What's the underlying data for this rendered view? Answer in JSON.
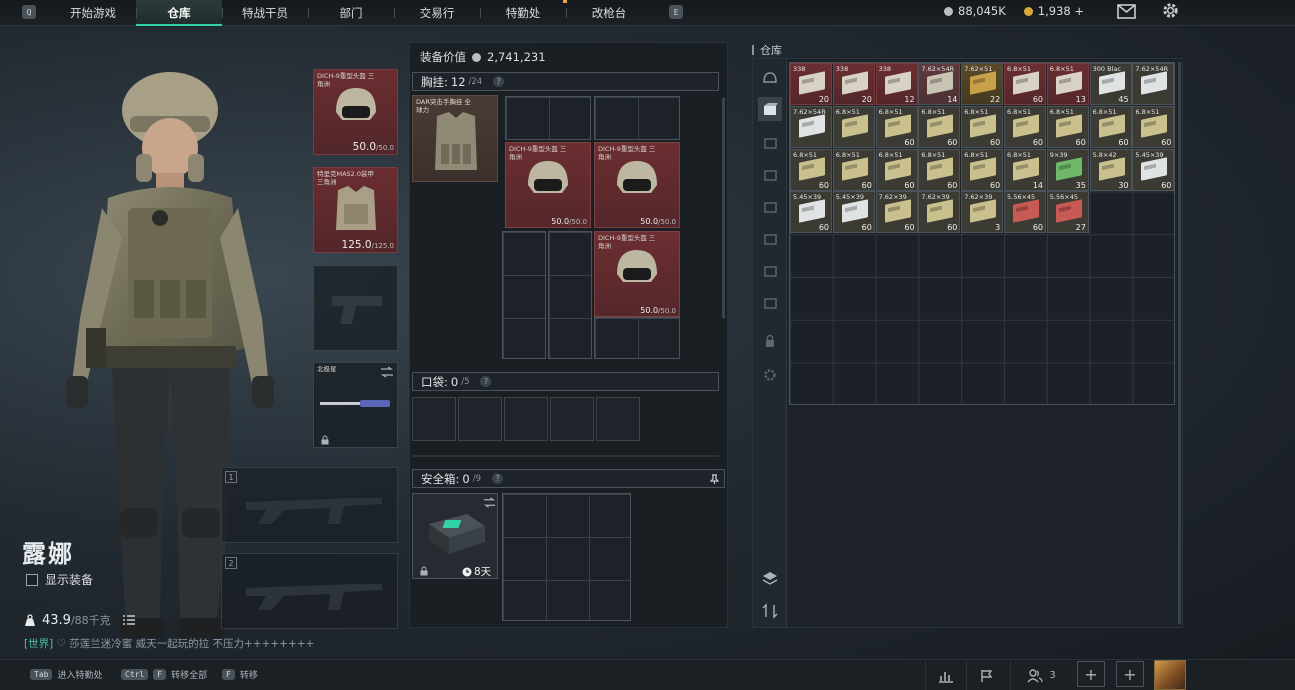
{
  "topbar": {
    "key_left": "Q",
    "key_right": "E",
    "tabs": [
      {
        "label": "开始游戏",
        "active": false
      },
      {
        "label": "仓库",
        "active": true
      },
      {
        "label": "特战干员",
        "active": false
      },
      {
        "label": "部门",
        "active": false
      },
      {
        "label": "交易行",
        "active": false
      },
      {
        "label": "特勤处",
        "active": false
      },
      {
        "label": "改枪台",
        "active": false
      }
    ],
    "currency_silver": "88,045K",
    "currency_gold": "1,938",
    "add_currency": "+",
    "accent_color": "#2fd3a5"
  },
  "character": {
    "name": "露娜",
    "show_gear_label": "显示装备",
    "weight_value": "43.9",
    "weight_max": "/88千克"
  },
  "chat": {
    "channel": "[世界]",
    "text": "♡ 莎莲兰迷冷蜜 威天一起玩的拉 不压力++++++++"
  },
  "equipment": {
    "helmet": {
      "label": "DICH-9重型头盔 三角洲",
      "durability": "50.0",
      "max": "/50.0"
    },
    "armor": {
      "label": "特里克MAS2.0装甲 三角洲",
      "durability": "125.0",
      "max": "/125.0"
    },
    "melee": {
      "label": "北极星"
    },
    "weapon_slots": [
      "1",
      "2"
    ]
  },
  "center": {
    "gear_value_label": "装备价值",
    "gear_value": "2,741,231",
    "chest_rig": {
      "label": "胸挂:",
      "used": "12",
      "cap": "/24",
      "help": "?"
    },
    "rig_item_label": "DAR突击手胸挂 全球力",
    "helmets": [
      {
        "label": "DICH-9重型头盔 三角洲",
        "durability": "50.0",
        "max": "/50.0"
      },
      {
        "label": "DICH-9重型头盔 三角洲",
        "durability": "50.0",
        "max": "/50.0"
      },
      {
        "label": "DICH-9重型头盔 三角洲",
        "durability": "50.0",
        "max": "/50.0"
      }
    ],
    "pocket": {
      "label": "口袋:",
      "used": "0",
      "cap": "/5",
      "help": "?"
    },
    "safebox": {
      "label": "安全箱:",
      "used": "0",
      "cap": "/9",
      "help": "?",
      "timer": "8天"
    }
  },
  "storage": {
    "title": "仓库",
    "items": [
      {
        "name": "338",
        "count": "20",
        "style": "red"
      },
      {
        "name": "338",
        "count": "20",
        "style": "red"
      },
      {
        "name": "338",
        "count": "12",
        "style": "red"
      },
      {
        "name": "7.62×54R",
        "count": "14",
        "style": "pink"
      },
      {
        "name": "7.62×51",
        "count": "22",
        "style": "gold"
      },
      {
        "name": "6.8×51",
        "count": "60",
        "style": "red"
      },
      {
        "name": "6.8×51",
        "count": "13",
        "style": "red"
      },
      {
        "name": "300 Blac",
        "count": "45",
        "style": "normal"
      },
      {
        "name": "7.62×54R",
        "count": "",
        "style": "normal"
      },
      {
        "name": "7.62×54R",
        "count": "",
        "style": "normal"
      },
      {
        "name": "6.8×51",
        "count": "",
        "style": "normal"
      },
      {
        "name": "6.8×51",
        "count": "60",
        "style": "normal"
      },
      {
        "name": "6.8×51",
        "count": "60",
        "style": "normal"
      },
      {
        "name": "6.8×51",
        "count": "60",
        "style": "normal"
      },
      {
        "name": "6.8×51",
        "count": "60",
        "style": "normal"
      },
      {
        "name": "6.8×51",
        "count": "60",
        "style": "normal"
      },
      {
        "name": "6.8×51",
        "count": "60",
        "style": "normal"
      },
      {
        "name": "6.8×51",
        "count": "60",
        "style": "normal"
      },
      {
        "name": "6.8×51",
        "count": "60",
        "style": "normal"
      },
      {
        "name": "6.8×51",
        "count": "60",
        "style": "normal"
      },
      {
        "name": "6.8×51",
        "count": "60",
        "style": "normal"
      },
      {
        "name": "6.8×51",
        "count": "60",
        "style": "normal"
      },
      {
        "name": "6.8×51",
        "count": "60",
        "style": "normal"
      },
      {
        "name": "6.8×51",
        "count": "14",
        "style": "normal"
      },
      {
        "name": "9×39",
        "count": "35",
        "style": "normal"
      },
      {
        "name": "5.8×42",
        "count": "30",
        "style": "normal"
      },
      {
        "name": "5.45×39",
        "count": "60",
        "style": "normal"
      },
      {
        "name": "5.45×39",
        "count": "60",
        "style": "normal"
      },
      {
        "name": "5.45×39",
        "count": "60",
        "style": "normal"
      },
      {
        "name": "7.62×39",
        "count": "60",
        "style": "normal"
      },
      {
        "name": "7.62×39",
        "count": "60",
        "style": "normal"
      },
      {
        "name": "7.62×39",
        "count": "3",
        "style": "normal"
      },
      {
        "name": "5.56×45",
        "count": "60",
        "style": "normal"
      },
      {
        "name": "5.56×45",
        "count": "27",
        "style": "normal"
      }
    ]
  },
  "bottombar": {
    "hint1_key": "Tab",
    "hint1_text": "进入特勤处",
    "hint2_key": "Ctrl",
    "hint2_key2": "F",
    "hint2_text": "转移全部",
    "hint3_key": "F",
    "hint3_text": "转移",
    "friends_count": "3"
  }
}
